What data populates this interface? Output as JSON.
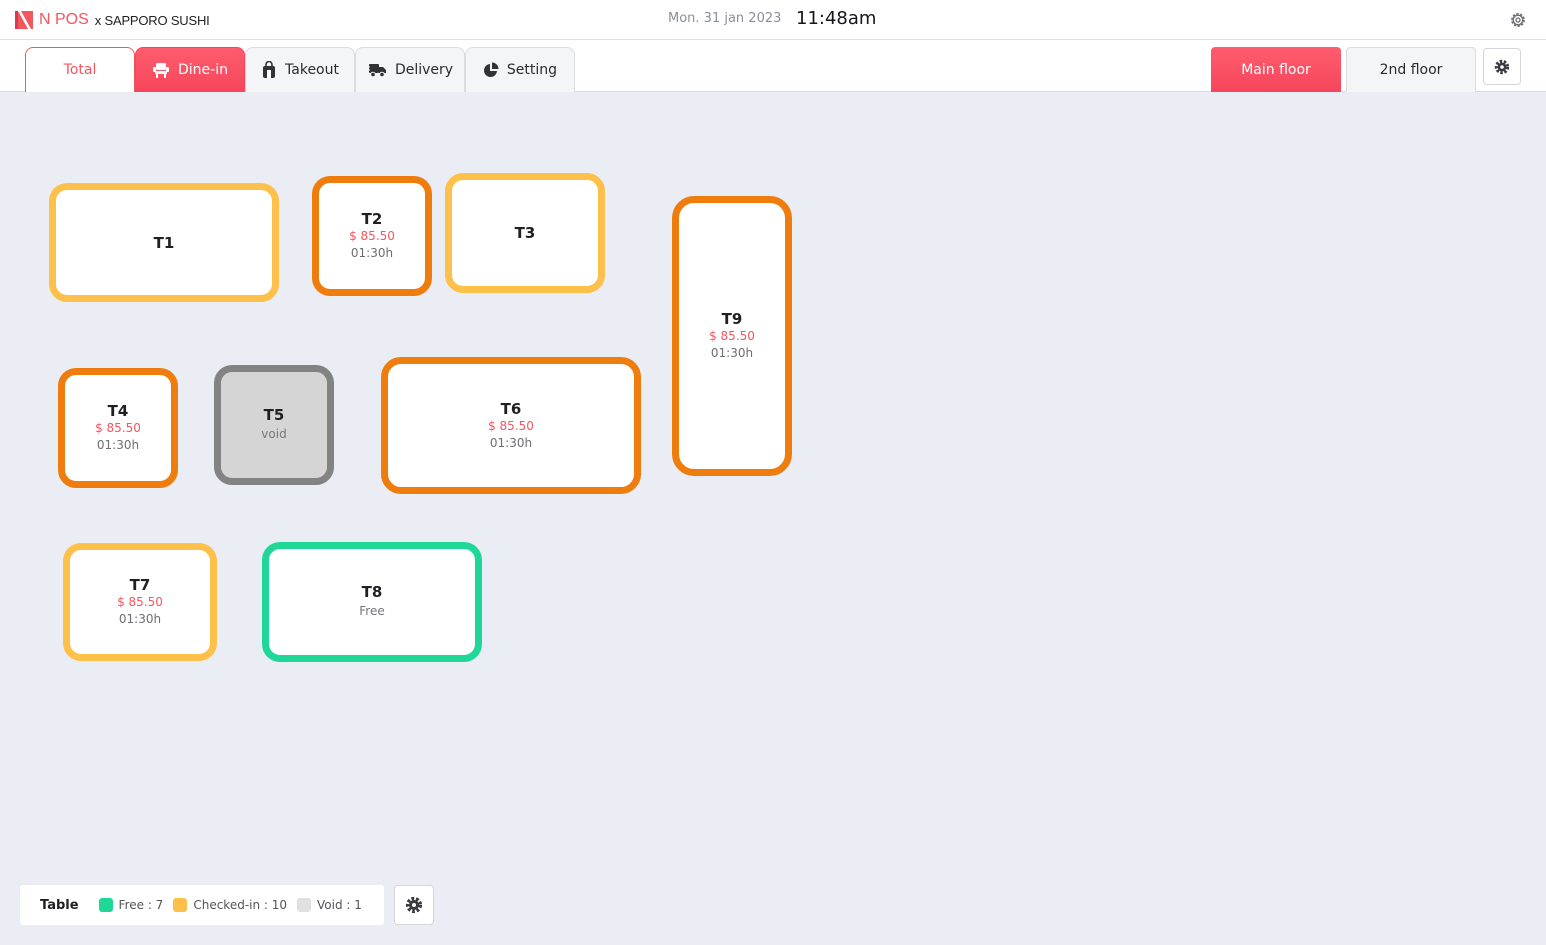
{
  "header": {
    "brand_name": "N POS",
    "brand_partner": "x SAPPORO SUSHI",
    "date": "Mon. 31 jan 2023",
    "time": "11:48am",
    "settings_icon": "gear-outline-icon"
  },
  "nav": {
    "tabs": [
      {
        "label": "Total",
        "active": false
      },
      {
        "label": "Dine-in",
        "active": true,
        "icon": "chair-icon"
      },
      {
        "label": "Takeout",
        "active": false,
        "icon": "shopping-bag-icon"
      },
      {
        "label": "Delivery",
        "active": false,
        "icon": "delivery-truck-icon"
      },
      {
        "label": "Setting",
        "active": false,
        "icon": "pie-chart-icon"
      }
    ],
    "floors": [
      {
        "label": "Main floor",
        "active": true
      },
      {
        "label": "2nd floor",
        "active": false
      }
    ]
  },
  "tables": [
    {
      "name": "T1",
      "status": "checked-in"
    },
    {
      "name": "T2",
      "status": "occupied",
      "amount": "$ 85.50",
      "time": "01:30h"
    },
    {
      "name": "T3",
      "status": "checked-in"
    },
    {
      "name": "T4",
      "status": "occupied",
      "amount": "$ 85.50",
      "time": "01:30h"
    },
    {
      "name": "T5",
      "status": "void",
      "status_text": "void"
    },
    {
      "name": "T6",
      "status": "occupied",
      "amount": "$ 85.50",
      "time": "01:30h"
    },
    {
      "name": "T7",
      "status": "checked-in",
      "amount": "$ 85.50",
      "time": "01:30h"
    },
    {
      "name": "T8",
      "status": "free",
      "status_text": "Free"
    },
    {
      "name": "T9",
      "status": "occupied",
      "amount": "$ 85.50",
      "time": "01:30h"
    }
  ],
  "legend": {
    "title": "Table",
    "items": [
      {
        "label": "Free : 7",
        "color": "#1fd898"
      },
      {
        "label": "Checked-in : 10",
        "color": "#fdc04a"
      },
      {
        "label": "Void : 1",
        "color": "#e0e0e0"
      }
    ]
  },
  "colors": {
    "accent": "#f6465c",
    "checked_in": "#fdc04a",
    "occupied": "#ef7d0d",
    "free": "#1fd898",
    "void": "#838383"
  }
}
